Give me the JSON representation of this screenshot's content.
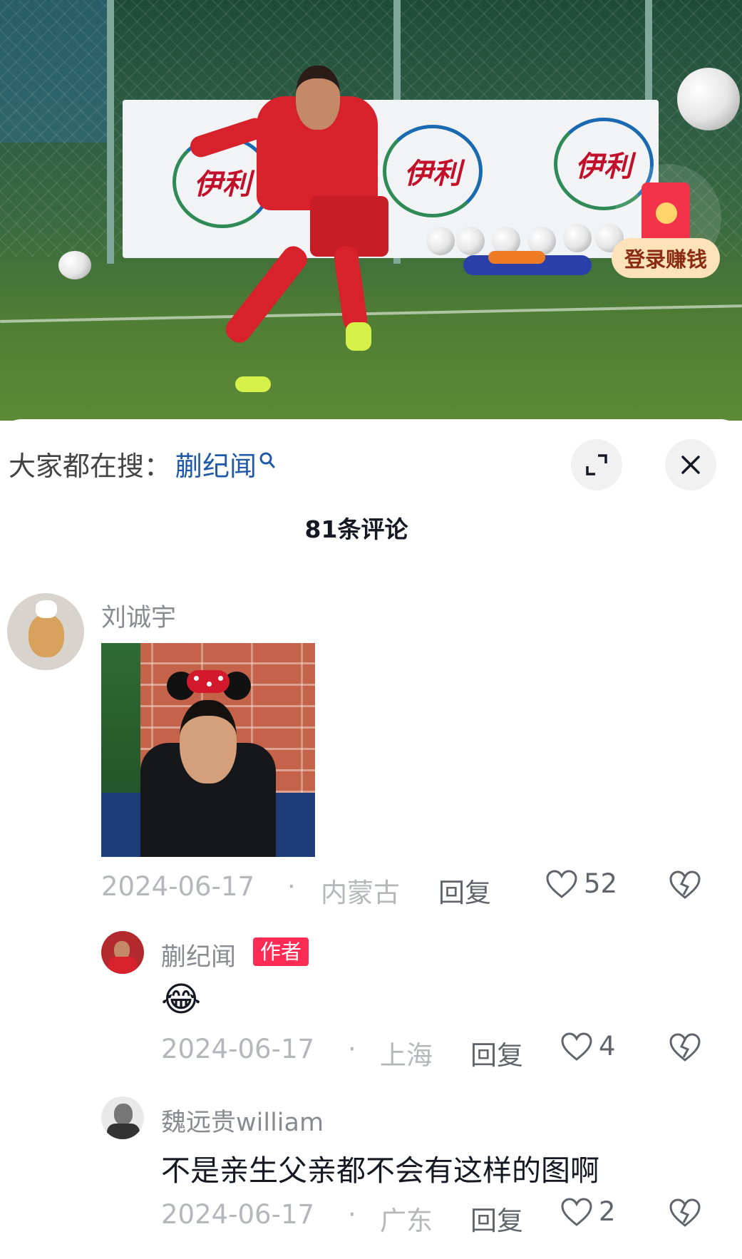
{
  "video": {
    "banner_text": "伊利",
    "reward_label": "登录赚钱"
  },
  "search": {
    "prefix": "大家都在搜：",
    "keyword": "蒯纪闻"
  },
  "comments_header": {
    "count_text": "81条评论"
  },
  "comments": [
    {
      "author": "刘诚宇",
      "date": "2024-06-17",
      "separator": "·",
      "location": "内蒙古",
      "reply_label": "回复",
      "likes": "52"
    },
    {
      "author": "蒯纪闻",
      "badge": "作者",
      "emoji": "😂",
      "date": "2024-06-17",
      "separator": "·",
      "location": "上海",
      "reply_label": "回复",
      "likes": "4"
    },
    {
      "author": "魏远贵william",
      "text": "不是亲生父亲都不会有这样的图啊",
      "date": "2024-06-17",
      "separator": "·",
      "location": "广东",
      "reply_label": "回复",
      "likes": "2"
    }
  ],
  "colors": {
    "accent_red": "#fe2c55",
    "search_blue": "#1f5aa8",
    "muted_text": "#b6b7bb"
  },
  "icons": [
    "search-icon",
    "expand-icon",
    "close-icon",
    "heart-icon",
    "dislike-icon",
    "red-packet-icon"
  ]
}
